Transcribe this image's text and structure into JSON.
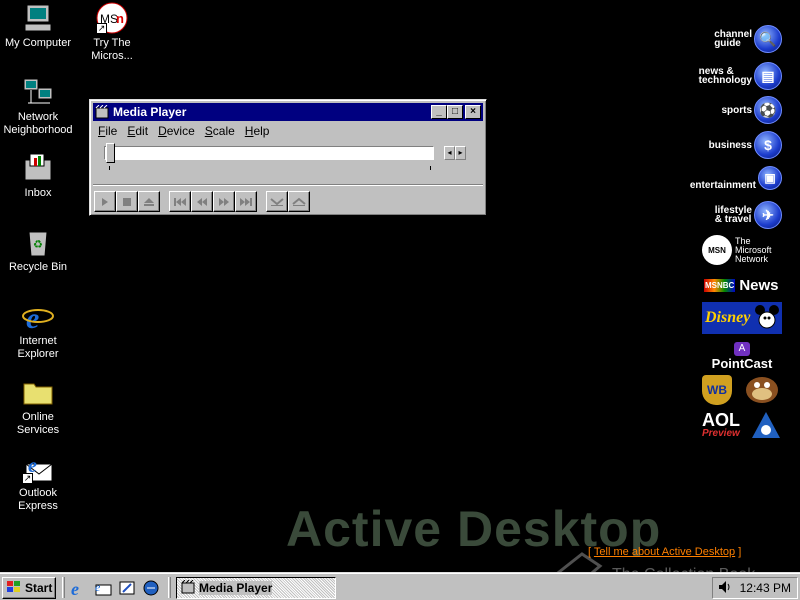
{
  "desktop": {
    "icons": [
      {
        "label": "My Computer",
        "icon": "my-computer-icon"
      },
      {
        "label": "Try The\nMicros...",
        "icon": "msn-icon"
      },
      {
        "label": "Network\nNeighborhood",
        "icon": "network-icon"
      },
      {
        "label": "Inbox",
        "icon": "inbox-icon"
      },
      {
        "label": "Recycle Bin",
        "icon": "recycle-bin-icon"
      },
      {
        "label": "Internet\nExplorer",
        "icon": "ie-icon"
      },
      {
        "label": "Online\nServices",
        "icon": "folder-icon"
      },
      {
        "label": "Outlook\nExpress",
        "icon": "outlook-icon"
      }
    ],
    "active_desktop_text": "Active Desktop",
    "tell_me_prefix": "[ ",
    "tell_me_link": "Tell me about Active Desktop",
    "tell_me_suffix": " ]",
    "watermark": "The Collection Book"
  },
  "media_player": {
    "title": "Media Player",
    "menu": [
      {
        "key": "F",
        "rest": "ile"
      },
      {
        "key": "E",
        "rest": "dit"
      },
      {
        "key": "D",
        "rest": "evice"
      },
      {
        "key": "S",
        "rest": "cale"
      },
      {
        "key": "H",
        "rest": "elp"
      }
    ],
    "title_buttons": {
      "minimize": "_",
      "maximize": "□",
      "close": "×"
    },
    "scroll_left": "◂",
    "scroll_right": "▸",
    "position": 0
  },
  "channel_bar": {
    "channels": [
      {
        "label": "channel\nguide",
        "icon": "magnifier-icon",
        "glyph": "🔍"
      },
      {
        "label": "news &\ntechnology",
        "icon": "news-icon",
        "glyph": "▤"
      },
      {
        "label": "sports",
        "icon": "sports-icon",
        "glyph": "⚽"
      },
      {
        "label": "business",
        "icon": "business-icon",
        "glyph": "$"
      },
      {
        "label": "entertainment",
        "icon": "entertainment-icon",
        "glyph": "▣"
      },
      {
        "label": "lifestyle\n& travel",
        "icon": "travel-icon",
        "glyph": "✈"
      }
    ],
    "msn": {
      "badge": "MSN",
      "text": "The\nMicrosoft\nNetwork"
    },
    "msnbc": {
      "badge": "MSNBC",
      "text": "News"
    },
    "disney": "Disney",
    "pointcast": "PointCast",
    "warner": "WB",
    "aol": "AOL",
    "aol_sub": "Preview"
  },
  "taskbar": {
    "start_label": "Start",
    "task_label": "Media Player",
    "clock": "12:43 PM"
  }
}
